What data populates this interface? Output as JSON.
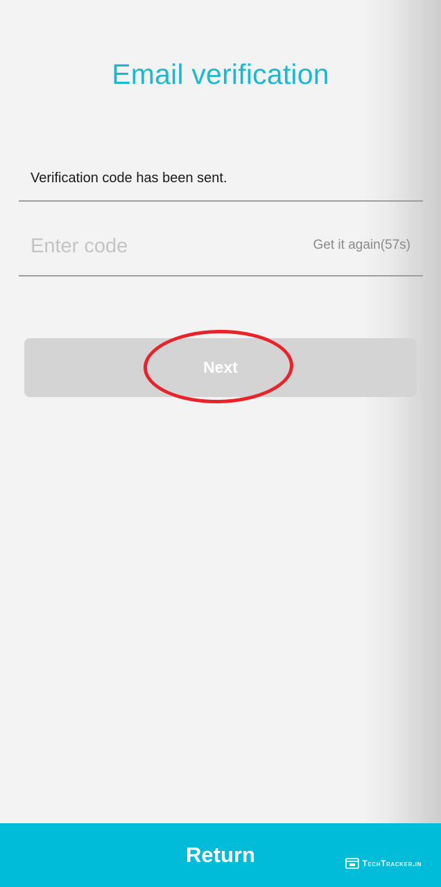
{
  "header": {
    "title": "Email verification"
  },
  "form": {
    "status_message": "Verification code has been sent.",
    "code_placeholder": "Enter code",
    "code_value": "",
    "resend_label": "Get it again(57s)"
  },
  "actions": {
    "next_label": "Next",
    "next_enabled": false
  },
  "footer": {
    "return_label": "Return",
    "watermark_text": "TechTracker.in"
  },
  "colors": {
    "accent": "#1bb9d0",
    "bottom_bar": "#00bcd8",
    "button_disabled": "#d4d4d4",
    "annotation": "#e8232a"
  }
}
